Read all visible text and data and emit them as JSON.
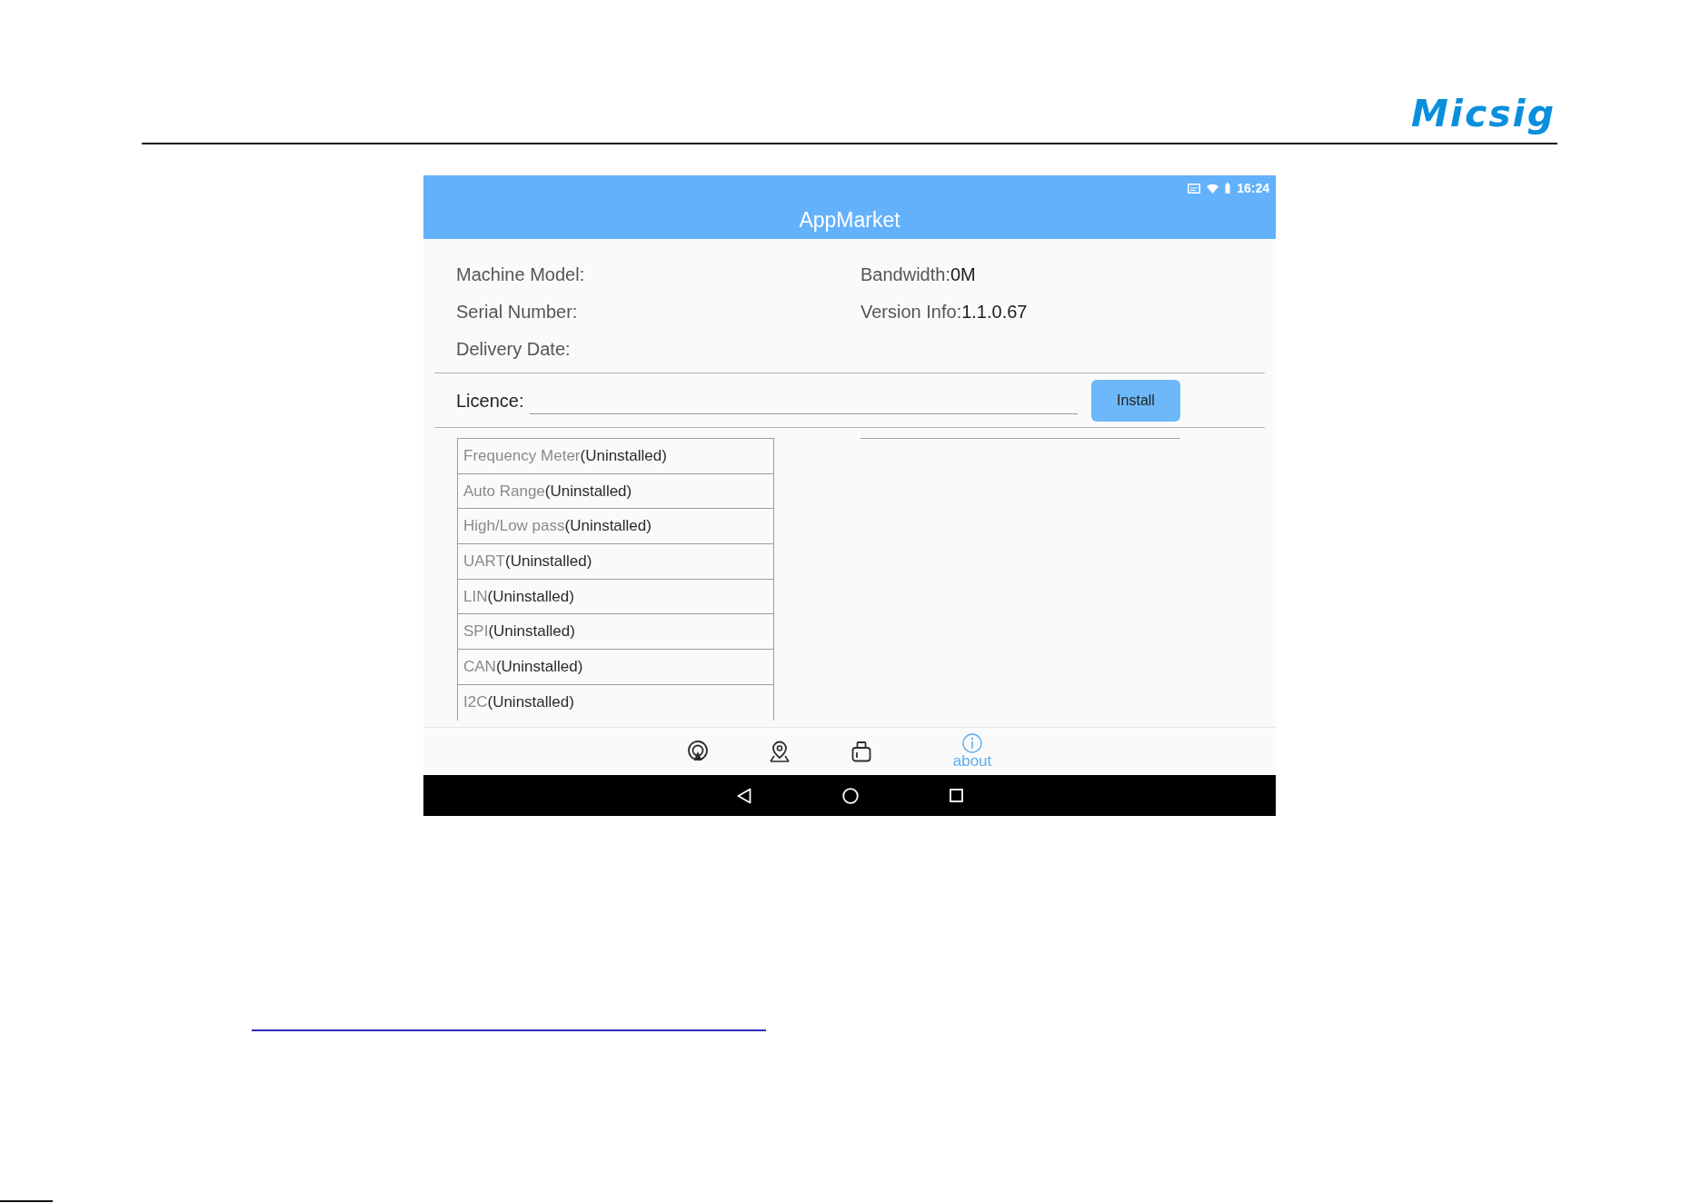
{
  "logo": "Micsig",
  "app_screen": {
    "status_bar": {
      "time": "16:24"
    },
    "title": "AppMarket",
    "device_info": [
      {
        "label": "Machine Model:"
      },
      {
        "label": "Bandwidth:",
        "value": "0M"
      },
      {
        "label": "Serial Number:"
      },
      {
        "label": "Version Info:",
        "value": "1.1.0.67"
      },
      {
        "label": "Delivery Date:"
      }
    ],
    "licence": {
      "label": "Licence:",
      "button": "Install"
    },
    "features": [
      {
        "name": "Frequency Meter",
        "status": "(Uninstalled)"
      },
      {
        "name": "Auto Range",
        "status": "(Uninstalled)"
      },
      {
        "name": "High/Low pass",
        "status": "(Uninstalled)"
      },
      {
        "name": "UART",
        "status": "(Uninstalled)"
      },
      {
        "name": "LIN",
        "status": "(Uninstalled)"
      },
      {
        "name": "SPI",
        "status": "(Uninstalled)"
      },
      {
        "name": "CAN",
        "status": "(Uninstalled)"
      },
      {
        "name": "I2C",
        "status": "(Uninstalled)"
      }
    ],
    "bottom_nav": [
      {
        "selected": false
      },
      {
        "selected": false
      },
      {
        "selected": false
      },
      {
        "label": "about",
        "selected": true
      }
    ]
  }
}
